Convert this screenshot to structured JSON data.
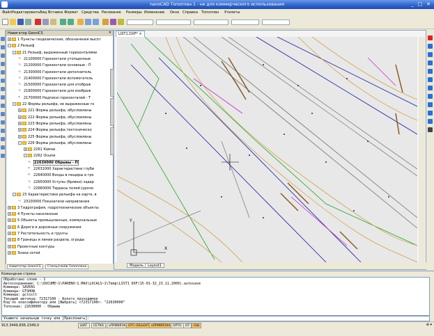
{
  "window": {
    "title": "nanoCAD Топоплан 1 - не для коммерческого использования",
    "btn_min": "_",
    "btn_max": "□",
    "btn_close": "✕"
  },
  "menu": [
    "Файл",
    "Редактировать",
    "Вид",
    "Вставка",
    "Формат",
    "Средства",
    "Рисование",
    "Размеры",
    "Изменение",
    "Окно",
    "Справка",
    "Топоплан",
    "Утилиты"
  ],
  "panel": {
    "title": "Навигатор GeoniCS",
    "close": "✕",
    "tree": [
      {
        "label": "1 Пункты геодезические, обозначения высот",
        "level": 1,
        "exp": "+",
        "icon": "folder"
      },
      {
        "label": "2 Рельеф",
        "level": 1,
        "exp": "-",
        "icon": "folder"
      },
      {
        "label": "21 Рельеф, выраженный горизонталями",
        "level": 2,
        "exp": "-",
        "icon": "folder"
      },
      {
        "label": "21100000 Горизонтали утолщенные",
        "level": 3,
        "exp": "",
        "icon": "line"
      },
      {
        "label": "21200000 Горизонтали основные - П",
        "level": 3,
        "exp": "",
        "icon": "line"
      },
      {
        "label": "21300000 Горизонтали дополнитель",
        "level": 3,
        "exp": "",
        "icon": "line"
      },
      {
        "label": "21400000 Горизонтали вспомогатель",
        "level": 3,
        "exp": "",
        "icon": "line"
      },
      {
        "label": "21500000 Горизонтали для отображ",
        "level": 3,
        "exp": "",
        "icon": "line"
      },
      {
        "label": "21600000 Горизонтали для изображ",
        "level": 3,
        "exp": "",
        "icon": "line"
      },
      {
        "label": "21700000 Надписи горизонталей - Т",
        "level": 3,
        "exp": "",
        "icon": "txt"
      },
      {
        "label": "22 Формы рельефа, не выраженные го",
        "level": 2,
        "exp": "-",
        "icon": "folder"
      },
      {
        "label": "221 Формы рельефа, обусловлены",
        "level": 3,
        "exp": "+",
        "icon": "folder"
      },
      {
        "label": "222 Формы рельефа, обусловлены",
        "level": 3,
        "exp": "+",
        "icon": "folder"
      },
      {
        "label": "223 Формы рельефа, обусловлены",
        "level": 3,
        "exp": "+",
        "icon": "folder"
      },
      {
        "label": "224 Формы рельефа тектоническо",
        "level": 3,
        "exp": "+",
        "icon": "folder"
      },
      {
        "label": "225 Формы рельефа, обусловлены",
        "level": 3,
        "exp": "+",
        "icon": "folder"
      },
      {
        "label": "226 Формы рельефа, обусловлены",
        "level": 3,
        "exp": "-",
        "icon": "folder"
      },
      {
        "label": "2261 Камни",
        "level": 4,
        "exp": "+",
        "icon": "folder"
      },
      {
        "label": "2262 Осыпи",
        "level": 4,
        "exp": "-",
        "icon": "folder"
      },
      {
        "label": "22630000 Обрывы - П",
        "level": 5,
        "exp": "",
        "icon": "line",
        "selected": true
      },
      {
        "label": "22631000 Характеристики глуби",
        "level": 5,
        "exp": "",
        "icon": "txt"
      },
      {
        "label": "22640000 Входы в пещеры и гро",
        "level": 5,
        "exp": "",
        "icon": "sym"
      },
      {
        "label": "22650000 Уступы (бровки) задер",
        "level": 5,
        "exp": "",
        "icon": "line"
      },
      {
        "label": "22660000 Террасы полей-(урочи",
        "level": 5,
        "exp": "",
        "icon": "line"
      },
      {
        "label": "23 Характеристики рельефа на карте, в",
        "level": 2,
        "exp": "-",
        "icon": "folder"
      },
      {
        "label": "23100000 Показатели направления",
        "level": 3,
        "exp": "",
        "icon": "line"
      },
      {
        "label": "3 Гидрография, гидротехнические объекты",
        "level": 1,
        "exp": "+",
        "icon": "folder"
      },
      {
        "label": "4 Пункты населенные",
        "level": 1,
        "exp": "+",
        "icon": "folder"
      },
      {
        "label": "5 Объекты промышленные, коммунальные",
        "level": 1,
        "exp": "+",
        "icon": "folder"
      },
      {
        "label": "6 Дороги и дорожные сооружения",
        "level": 1,
        "exp": "+",
        "icon": "folder"
      },
      {
        "label": "7 Растительность и грунты",
        "level": 1,
        "exp": "+",
        "icon": "folder"
      },
      {
        "label": "8 Границы и линии раздела, ограды",
        "level": 1,
        "exp": "+",
        "icon": "folder"
      },
      {
        "label": "Проектные контуры",
        "level": 1,
        "exp": "+",
        "icon": "folder"
      },
      {
        "label": "Знаки сетей",
        "level": 1,
        "exp": "+",
        "icon": "folder"
      }
    ],
    "tabs": [
      "Навигатор GeoniCS",
      "Стиль/слоёв Топоплана"
    ]
  },
  "drawing": {
    "tab": "LIST1.DXF*",
    "tab_close": "×",
    "layout_tabs": [
      "Модель",
      "Layout1"
    ],
    "axis_x": "X",
    "axis_y": "Y",
    "colors": {
      "contour": "#d2a24a",
      "green": "#1fa51f",
      "blue": "#1a1aa6",
      "magenta": "#c22bc2",
      "grey": "#808080",
      "road": "#707070"
    }
  },
  "command": {
    "title": "Командная строка",
    "history": [
      "Обработано слоев - 1",
      "Автосохранение: C:\\DOCUME~1\\PARENO~1.MAS\\LOCALS~1\\Temp\\LIST1 DXF(15-01-32_23.11.2009).autosave",
      "Команда: SAVEAS",
      "Команда: GTSHOW",
      "Команда: gcloslt",
      "Текущий автокод: 72317100 - Болото проходимое",
      "Код по классификатору или [Выбрать] <72317100>: \"22630000\"",
      "Топознак: 22630000 - Обрывы"
    ],
    "prompt": "Укажите начальную точку или [Прислонить]:"
  },
  "status": {
    "coords": "913.3449,836.2349,0",
    "buttons": [
      {
        "label": "ШАГ",
        "on": false
      },
      {
        "label": "СЕТКА",
        "on": false
      },
      {
        "label": "оПРИВЯЗКА",
        "on": false
      },
      {
        "label": "ОТС-ОБЪЕКТ",
        "on": true
      },
      {
        "label": "оПРИВЯЗКА",
        "on": true
      },
      {
        "label": "ОРТО",
        "on": false
      },
      {
        "label": "ОТ",
        "on": false
      },
      {
        "label": "ОШ",
        "on": true
      }
    ],
    "right": "⊕ ▾"
  }
}
